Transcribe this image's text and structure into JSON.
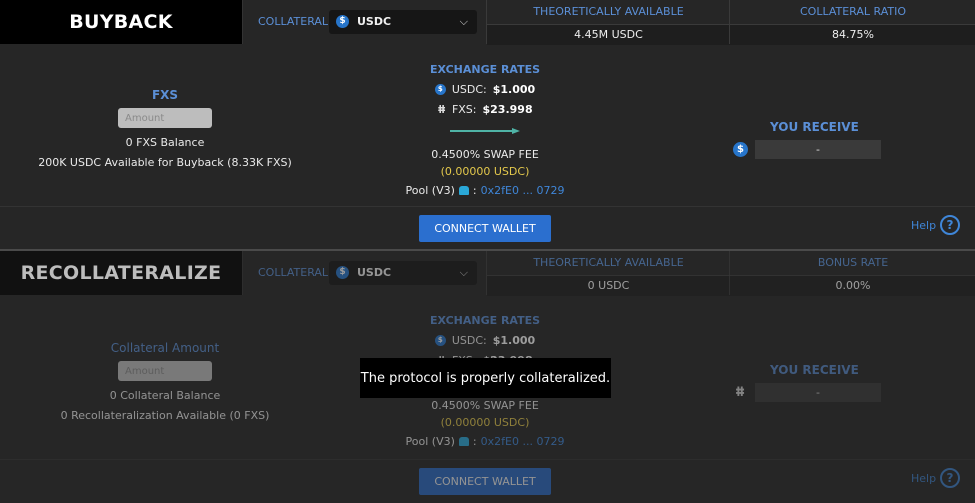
{
  "buyback": {
    "title": "BUYBACK",
    "collateral_label": "COLLATERAL",
    "collateral_value": "USDC",
    "stats": [
      {
        "label": "THEORETICALLY AVAILABLE",
        "value": "4.45M USDC"
      },
      {
        "label": "COLLATERAL RATIO",
        "value": "84.75%"
      }
    ],
    "input_token": "FXS",
    "amount_placeholder": "Amount",
    "balance": "0 FXS Balance",
    "available": "200K USDC Available for Buyback (8.33K FXS)",
    "exchange_title": "EXCHANGE RATES",
    "rates": [
      {
        "token": "USDC:",
        "value": "$1.000",
        "icon": "usdc-icon"
      },
      {
        "token": "FXS:",
        "value": "$23.998",
        "icon": "fxs-icon"
      }
    ],
    "swap_fee": "0.4500% SWAP FEE",
    "fee_amount": "(0.00000 USDC)",
    "pool_label": "Pool (V3)",
    "pool_sep": ":",
    "pool_address": "0x2fE0 ... 0729",
    "receive_title": "YOU RECEIVE",
    "receive_value": "-",
    "connect_label": "CONNECT WALLET",
    "help_label": "Help",
    "help_icon": "?"
  },
  "recollateralize": {
    "title": "RECOLLATERALIZE",
    "collateral_label": "COLLATERAL",
    "collateral_value": "USDC",
    "stats": [
      {
        "label": "THEORETICALLY AVAILABLE",
        "value": "0 USDC"
      },
      {
        "label": "BONUS RATE",
        "value": "0.00%"
      }
    ],
    "input_token": "Collateral Amount",
    "amount_placeholder": "Amount",
    "balance": "0 Collateral Balance",
    "available": "0 Recollateralization Available (0 FXS)",
    "exchange_title": "EXCHANGE RATES",
    "rates": [
      {
        "token": "USDC:",
        "value": "$1.000",
        "icon": "usdc-icon"
      },
      {
        "token": "FXS:",
        "value": "$23.998",
        "icon": "fxs-icon"
      }
    ],
    "swap_fee": "0.4500% SWAP FEE",
    "fee_amount": "(0.00000 USDC)",
    "pool_label": "Pool (V3)",
    "pool_sep": ":",
    "pool_address": "0x2fE0 ... 0729",
    "receive_title": "YOU RECEIVE",
    "receive_value": "-",
    "connect_label": "CONNECT WALLET",
    "help_label": "Help",
    "help_icon": "?"
  },
  "tooltip": "The protocol is properly collateralized.",
  "icons": {
    "usdc": "$",
    "fxs": "ⵌ",
    "chevron": "⌄"
  }
}
